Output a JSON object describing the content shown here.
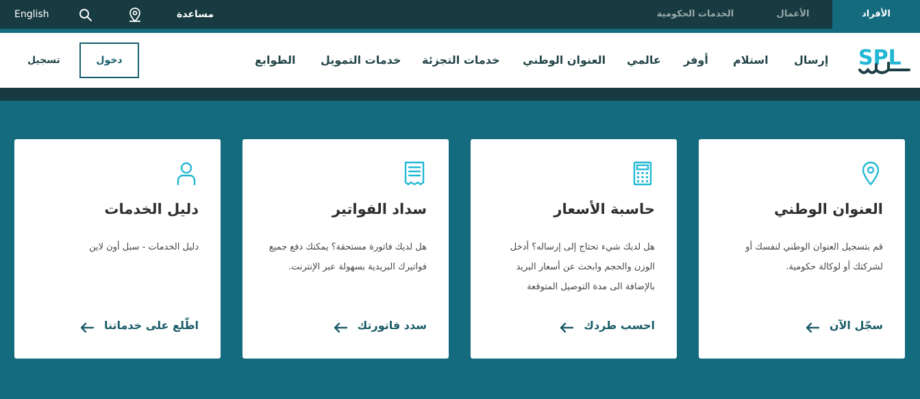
{
  "topbar": {
    "tabs": [
      "الأفراد",
      "الأعمال",
      "الخدمات الحكومية"
    ],
    "help": "مساعدة",
    "language": "English",
    "icons": [
      "location-pin-icon",
      "search-icon"
    ]
  },
  "header": {
    "logo_text": "SPL",
    "nav": [
      "إرسال",
      "استلام",
      "أوفر",
      "عالمي",
      "العنوان الوطني",
      "خدمات التجزئة",
      "خدمات التمويل",
      "الطوابع"
    ],
    "login": "دخول",
    "register": "تسجيل"
  },
  "cards": [
    {
      "icon": "location-pin-icon",
      "title": "العنوان الوطني",
      "description": "قم بتسجيل العنوان الوطني لنفسك أو لشركتك أو لوكالة حكومية.",
      "link": "سجّل الآن"
    },
    {
      "icon": "calculator-icon",
      "title": "حاسبة الأسعار",
      "description": "هل لديك شيء تحتاج إلى إرساله؟ أدخل الوزن والحجم وابحث عن أسعار البريد بالإضافة الى مدة التوصيل المتوقعة",
      "link": "احسب طردك"
    },
    {
      "icon": "receipt-icon",
      "title": "سداد الفواتير",
      "description": "هل لديك فاتورة مستحقة؟ يمكنك دفع جميع فواتيرك البريدية بسهولة عبر الإنترنت.",
      "link": "سدد فاتورتك"
    },
    {
      "icon": "user-icon",
      "title": "دليل الخدمات",
      "description": "دليل الخدمات - سبل أون لاين",
      "link": "اطّلع على خدماتنا"
    }
  ],
  "colors": {
    "brand_teal": "#146b7e",
    "dark": "#173b41",
    "accent_cyan": "#22b8d4",
    "link": "#1a5b68"
  }
}
